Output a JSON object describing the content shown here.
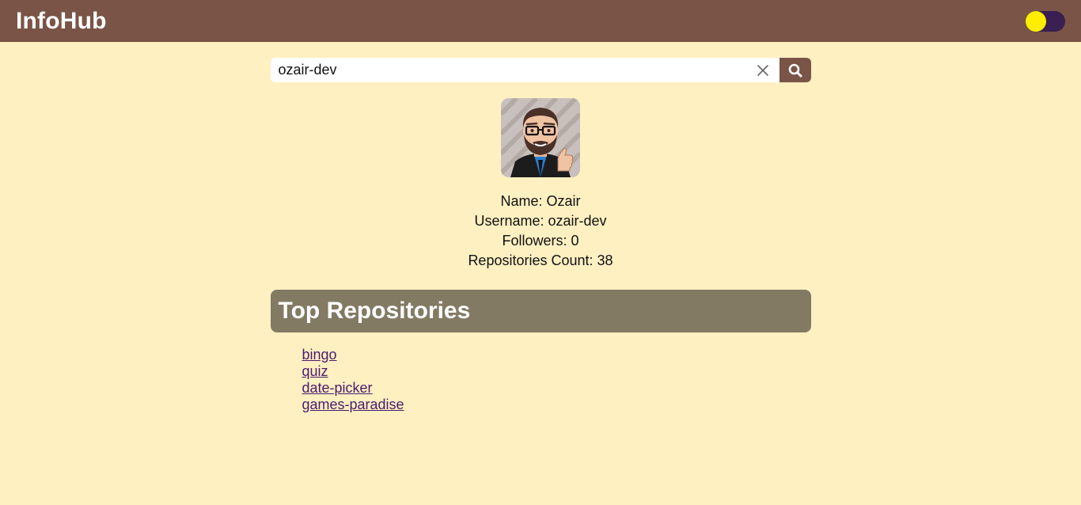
{
  "header": {
    "brand": "InfoHub",
    "theme_toggle": {
      "state": "light",
      "knob_color": "#ffee00",
      "track_color": "#3a1f52"
    }
  },
  "search": {
    "value": "ozair-dev",
    "clear_icon": "close-icon",
    "submit_icon": "search-icon"
  },
  "profile": {
    "avatar": "cartoon-avatar-icon",
    "name_line": "Name: Ozair",
    "username_line": "Username: ozair-dev",
    "followers_line": "Followers: 0",
    "repos_count_line": "Repositories Count: 38"
  },
  "repos": {
    "heading": "Top Repositories",
    "items": [
      {
        "label": "bingo"
      },
      {
        "label": "quiz"
      },
      {
        "label": "date-picker"
      },
      {
        "label": "games-paradise"
      }
    ]
  },
  "colors": {
    "header_bg": "#7a5446",
    "page_bg": "#fff0c2",
    "section_header_bg": "#837a64",
    "link": "#4b1a6e"
  }
}
